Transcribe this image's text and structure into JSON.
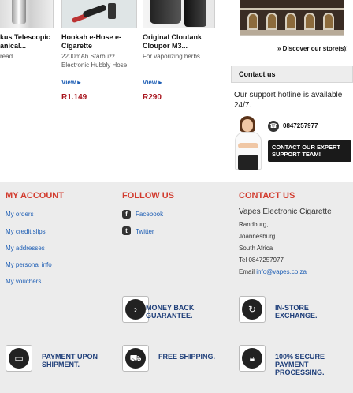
{
  "products": [
    {
      "title_line1": "kus Telescopic",
      "title_line2": "anical...",
      "desc": "read",
      "view": "",
      "price": ""
    },
    {
      "title_line1": "Hookah e-Hose e-",
      "title_line2": "Cigarette",
      "desc_line1": "2200mAh Starbuzz",
      "desc_line2": "Electronic Hubbly Hose",
      "view": "View",
      "price": "R1.149"
    },
    {
      "title_line1": "Original Cloutank",
      "title_line2": "Cloupor M3...",
      "desc_line1": "For vaporizing herbs",
      "view": "View",
      "price": "R290"
    }
  ],
  "store": {
    "discover": "» Discover our store(s)!"
  },
  "contact_box": {
    "heading": "Contact us",
    "hotline": "Our support hotline is available 24/7.",
    "phone": "0847257977",
    "button_line1": "CONTACT OUR EXPERT",
    "button_line2": "SUPPORT TEAM!"
  },
  "footer": {
    "account": {
      "heading": "MY ACCOUNT",
      "links": [
        "My orders",
        "My credit slips",
        "My addresses",
        "My personal info",
        "My vouchers"
      ]
    },
    "follow": {
      "heading": "FOLLOW US",
      "links": [
        "Facebook",
        "Twitter"
      ]
    },
    "contact": {
      "heading": "CONTACT US",
      "company": "Vapes Electronic Cigarette",
      "lines": [
        "Randburg,",
        "Joannesburg",
        "South Africa",
        "Tel 0847257977"
      ],
      "email_label": "Email",
      "email": "info@vapes.co.za"
    },
    "badges": [
      {
        "line1": "MONEY BACK",
        "line2": "GUARANTEE.",
        "icon": "money-back-icon"
      },
      {
        "line1": "IN-STORE",
        "line2": "EXCHANGE.",
        "icon": "exchange-icon"
      },
      {
        "line1": "PAYMENT UPON",
        "line2": "SHIPMENT.",
        "icon": "payment-icon"
      },
      {
        "line1": "FREE SHIPPING.",
        "icon": "truck-icon"
      },
      {
        "line1": "100% SECURE",
        "line2": "PAYMENT",
        "line3": "PROCESSING.",
        "icon": "lock-icon"
      }
    ]
  },
  "colors": {
    "accent_red": "#d23b2e",
    "price_red": "#a8141d",
    "link_blue": "#1f5fb5",
    "badge_navy": "#1f3f7a"
  }
}
